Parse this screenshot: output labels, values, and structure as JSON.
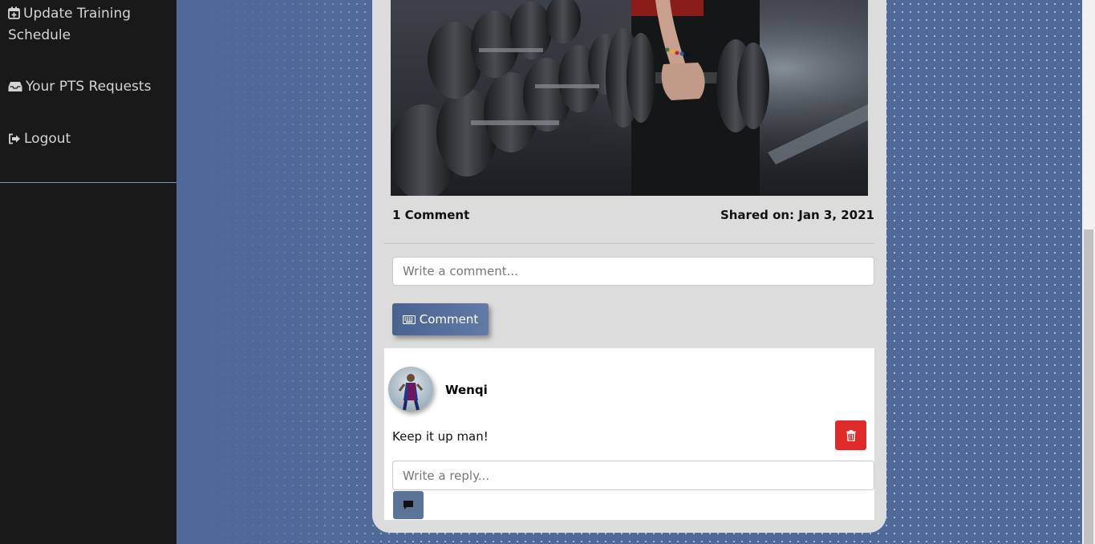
{
  "sidebar": {
    "items": [
      {
        "label": "Update Training Schedule",
        "icon": "calendar-plus-icon"
      },
      {
        "label": "Your PTS Requests",
        "icon": "inbox-icon"
      },
      {
        "label": "Logout",
        "icon": "sign-out-icon"
      }
    ]
  },
  "post": {
    "image_alt": "gym-dumbbells-photo",
    "comment_count": "1 Comment",
    "shared_on": "Shared on: Jan 3, 2021",
    "comment_placeholder": "Write a comment...",
    "comment_button": "Comment",
    "comments": [
      {
        "author": "Wenqi",
        "text": "Keep it up man!",
        "reply_placeholder": "Write a reply..."
      }
    ]
  },
  "colors": {
    "sidebar_bg": "#191919",
    "page_bg": "#4f6a98",
    "card_bg": "#dcdcdc",
    "accent": "#5c7398",
    "danger": "#e02a2a"
  }
}
